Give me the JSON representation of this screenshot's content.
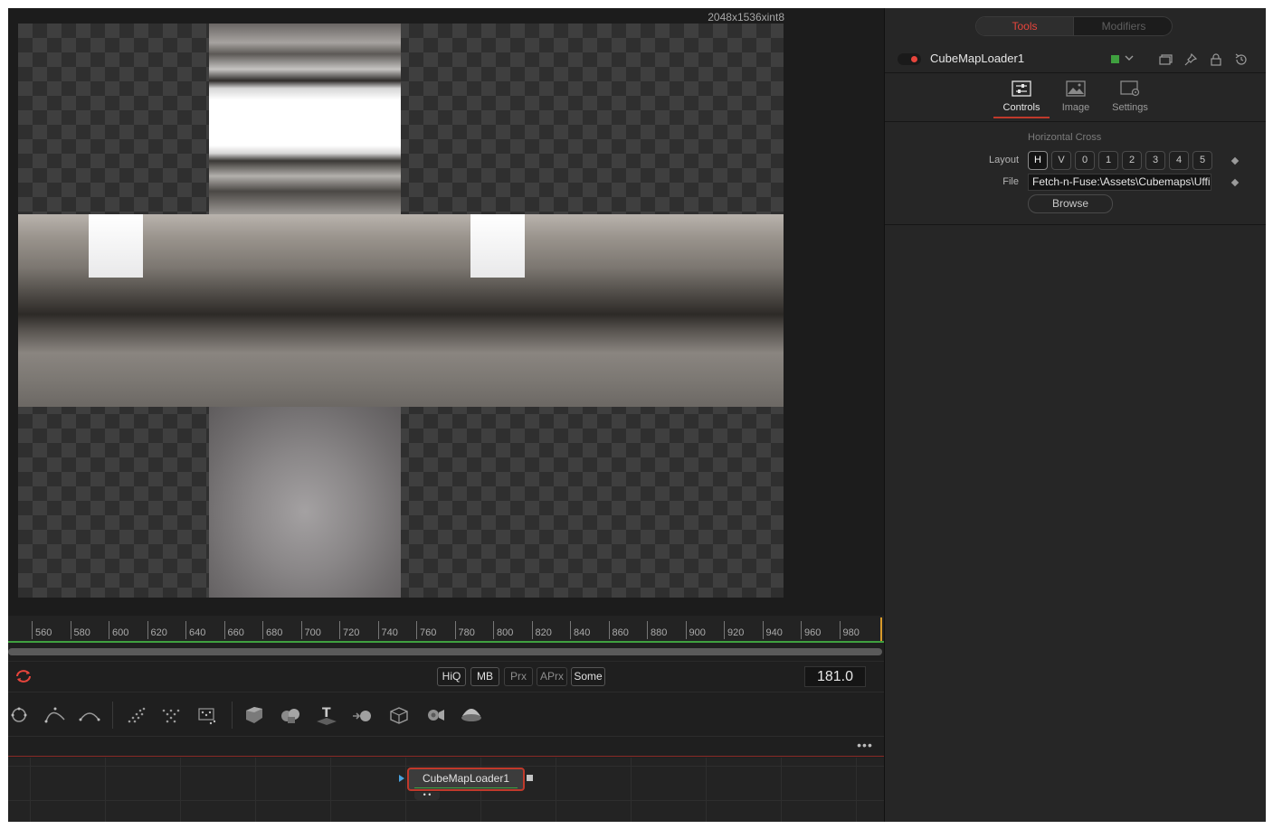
{
  "viewer": {
    "resolution_label": "2048x1536xint8"
  },
  "timeline": {
    "ticks": [
      "560",
      "580",
      "600",
      "620",
      "640",
      "660",
      "680",
      "700",
      "720",
      "740",
      "760",
      "780",
      "800",
      "820",
      "840",
      "860",
      "880",
      "900",
      "920",
      "940",
      "960",
      "980"
    ],
    "current_frame": "181.0",
    "loop_icon": "loop-icon",
    "buttons": [
      {
        "label": "HiQ",
        "active": true
      },
      {
        "label": "MB",
        "active": true
      },
      {
        "label": "Prx",
        "active": false
      },
      {
        "label": "APrx",
        "active": false
      },
      {
        "label": "Some",
        "active": true
      }
    ]
  },
  "toolbar": {
    "tools": [
      "polygon-mask-icon",
      "bspline-mask-icon",
      "bitmap-mask-icon",
      "particle-emitter-icon",
      "particle-render-icon",
      "pixel-emitter-icon",
      "shape3d-icon",
      "merge3d-icon",
      "text3d-icon",
      "renderer3d-icon",
      "fbx-icon",
      "camera3d-icon",
      "spotlight-icon"
    ]
  },
  "node_editor": {
    "more_label": "•••",
    "node": {
      "name": "CubeMapLoader1",
      "ctl_label": "• •"
    }
  },
  "inspector": {
    "tabs": {
      "tools": "Tools",
      "modifiers": "Modifiers"
    },
    "tool": {
      "name": "CubeMapLoader1",
      "color": "#3fa03f"
    },
    "control_tabs": [
      {
        "label": "Controls",
        "icon": "sliders-icon",
        "active": true
      },
      {
        "label": "Image",
        "icon": "image-icon",
        "active": false
      },
      {
        "label": "Settings",
        "icon": "settings-icon",
        "active": false
      }
    ],
    "controls": {
      "layout_caption": "Horizontal Cross",
      "layout_label": "Layout",
      "layout_options": [
        "H",
        "V",
        "0",
        "1",
        "2",
        "3",
        "4",
        "5"
      ],
      "layout_selected": "H",
      "file_label": "File",
      "file_value": "Fetch-n-Fuse:\\Assets\\Cubemaps\\Uffizi",
      "browse_label": "Browse"
    }
  },
  "colors": {
    "accent": "#e8453c",
    "panel": "#262626",
    "viewer": "#1c1c1c",
    "tool_color": "#3fa03f"
  }
}
